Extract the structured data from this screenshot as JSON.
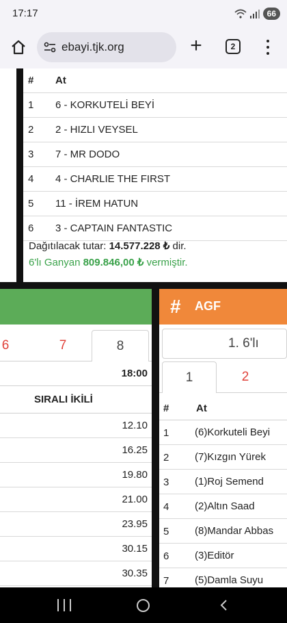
{
  "status": {
    "time": "17:17",
    "battery": "66"
  },
  "browser": {
    "url": "ebayi.tjk.org",
    "tab_count": "2"
  },
  "top_table": {
    "headers": [
      "#",
      "At"
    ],
    "rows": [
      [
        "1",
        "6 - KORKUTELİ BEYİ"
      ],
      [
        "2",
        "2 - HIZLI VEYSEL"
      ],
      [
        "3",
        "7 - MR DODO"
      ],
      [
        "4",
        "4 - CHARLIE THE FIRST"
      ],
      [
        "5",
        "11 - İREM HATUN"
      ],
      [
        "6",
        "3 - CAPTAIN FANTASTIC"
      ]
    ],
    "distribution_label": "Dağıtılacak tutar:",
    "distribution_amount": "14.577.228 ₺",
    "distribution_suffix": "dir.",
    "ganyan_label": "6'lı Ganyan",
    "ganyan_amount": "809.846,00 ₺",
    "ganyan_suffix": "vermiştir."
  },
  "left_panel": {
    "race_tabs": [
      "6",
      "7",
      "8"
    ],
    "time": "18:00",
    "column_header": "SIRALI İKİLİ",
    "values": [
      "12.10",
      "16.25",
      "19.80",
      "21.00",
      "23.95",
      "30.15",
      "30.35"
    ]
  },
  "right_panel": {
    "title": "AGF",
    "hash": "#",
    "six_tab": "1. 6'lı",
    "sub_tabs": [
      "1",
      "2"
    ],
    "headers": [
      "#",
      "At"
    ],
    "rows": [
      [
        "1",
        "(6)Korkuteli Beyi"
      ],
      [
        "2",
        "(7)Kızgın Yürek"
      ],
      [
        "3",
        "(1)Roj Semend"
      ],
      [
        "4",
        "(2)Altın Saad"
      ],
      [
        "5",
        "(8)Mandar Abbas"
      ],
      [
        "6",
        "(3)Editör"
      ],
      [
        "7",
        "(5)Damla Suyu"
      ]
    ]
  },
  "colors": {
    "green_header": "#5cac58",
    "orange_header": "#f0883a",
    "red_tab": "#e0423a",
    "ganyan_green": "#3aa24a"
  }
}
